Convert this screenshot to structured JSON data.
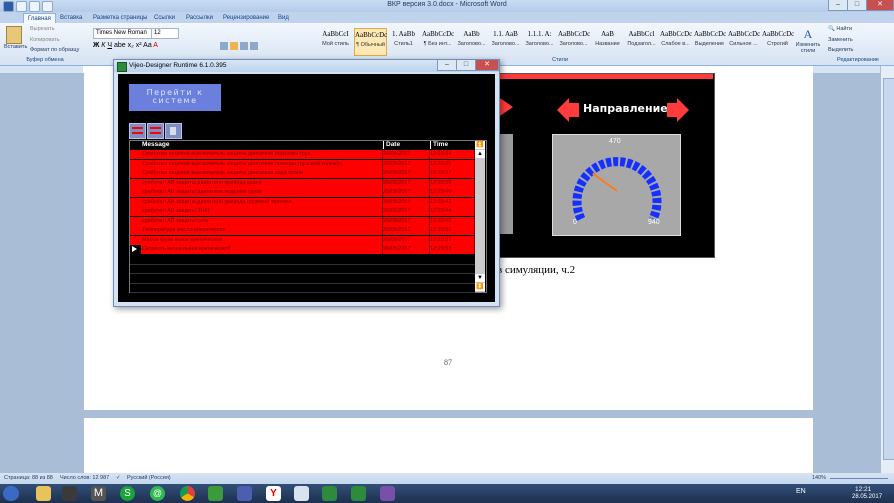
{
  "word": {
    "title": "ВКР версия 3.0.docx - Microsoft Word",
    "tabs": [
      "Главная",
      "Вставка",
      "Разметка страницы",
      "Ссылки",
      "Рассылки",
      "Рецензирование",
      "Вид"
    ],
    "clipboard": {
      "paste": "Вставить",
      "cut": "Вырезать",
      "copy": "Копировать",
      "format": "Формат по образцу",
      "group": "Буфер обмена"
    },
    "font": {
      "name": "Times New Roman",
      "size": "12"
    },
    "styles": [
      {
        "sample": "AaBbCcI",
        "name": "Мой стиль"
      },
      {
        "sample": "AaBbCcDc",
        "name": "¶ Обычный"
      },
      {
        "sample": "1. AaBb",
        "name": "Стиль1"
      },
      {
        "sample": "AaBbCcDc",
        "name": "¶ Без инт..."
      },
      {
        "sample": "AaBb",
        "name": "Заголово..."
      },
      {
        "sample": "1.1. AaB",
        "name": "Заголово..."
      },
      {
        "sample": "1.1.1. A:",
        "name": "Заголово..."
      },
      {
        "sample": "AaBbCcDc",
        "name": "Заголово..."
      },
      {
        "sample": "AaB",
        "name": "Название"
      },
      {
        "sample": "AaBbCcl",
        "name": "Подзагол..."
      },
      {
        "sample": "AaBbCcDc",
        "name": "Слабое в..."
      },
      {
        "sample": "AaBbCcDc",
        "name": "Выделение"
      },
      {
        "sample": "AaBbCcDc",
        "name": "Сильное ..."
      },
      {
        "sample": "AaBbCcDc",
        "name": "Строгий"
      }
    ],
    "styles_group": "Стили",
    "change_styles": "Изменить стили",
    "editing": {
      "find": "Найти",
      "replace": "Заменить",
      "select": "Выделить",
      "group": "Редактирование"
    },
    "doc_text": "в симуляции, ч.2",
    "page_number": "87",
    "hmi_direction": "Направление",
    "gauge": {
      "max": "470",
      "left": "0",
      "right": "940",
      "value_fraction": 0.3
    }
  },
  "vijeo": {
    "title": "Vijeo-Designer Runtime 6.1.0.395",
    "goto_button": "Перейти к системе",
    "columns": [
      "Message",
      "Date",
      "Time"
    ],
    "rows": [
      {
        "message": "Сработал лицевой выключатель защиты двигателя подъемы груз",
        "date": "20/05/2017",
        "time": "12:20:34"
      },
      {
        "message": "Сработал лицевой выключатель защиты двигателя привода грузовой тележки",
        "date": "20/05/2017",
        "time": "12:20:36"
      },
      {
        "message": "Сработал лицевой выключатель защиты двигателя хода крана",
        "date": "20/05/2017",
        "time": "12:20:37"
      },
      {
        "message": "сработал АВ защиты двигателя привода крана",
        "date": "20/05/2017",
        "time": "12:20:38"
      },
      {
        "message": "сработал АВ защиты двигателя подъема груза",
        "date": "20/05/2017",
        "time": "12:20:40"
      },
      {
        "message": "сработал АВ защиты двигателя привода грузовой тележки",
        "date": "20/05/2017",
        "time": "12:20:42"
      },
      {
        "message": "сработал АВ защиты ЗНКГ",
        "date": "20/05/2017",
        "time": "12:20:44"
      },
      {
        "message": "сработал АВ защиты сети",
        "date": "20/05/2017",
        "time": "12:20:46"
      },
      {
        "message": "Температура масла критическая",
        "date": "20/05/2017",
        "time": "12:20:50"
      },
      {
        "message": "Масса груза выше критической",
        "date": "20/05/2017",
        "time": "12:20:51"
      },
      {
        "message": "Скорость ветра выше критической",
        "date": "20/05/2017",
        "time": "12:20:53"
      }
    ]
  },
  "status": {
    "page": "Страница: 88 из 88",
    "words": "Число слов: 12 987",
    "lang": "Русский (Россия)",
    "zoom": "140%"
  },
  "tray": {
    "lang": "EN",
    "time": "12:21",
    "date": "28.05.2017"
  },
  "colors": {
    "alarm_red": "#ff0000",
    "hmi_arrow": "#ff3b3b",
    "gauge_blue": "#1430ff",
    "button_blue": "#6a80dc"
  }
}
